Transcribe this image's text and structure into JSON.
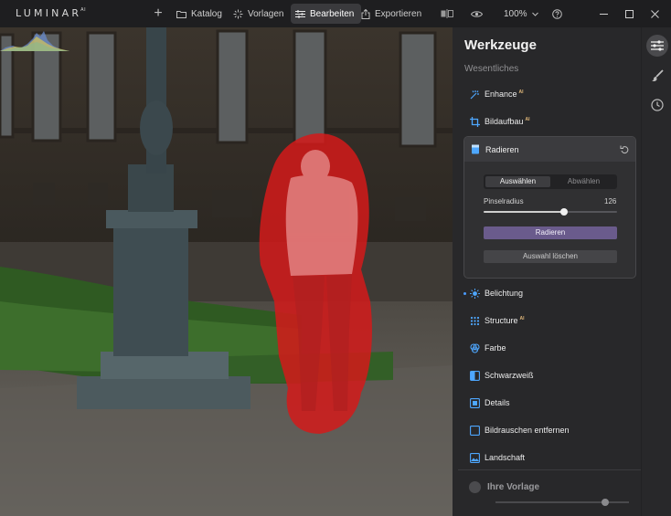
{
  "app": {
    "logo_text": "LUMINAR",
    "logo_suffix": "AI"
  },
  "toolbar": {
    "add_label": "+",
    "katalog_label": "Katalog",
    "vorlagen_label": "Vorlagen",
    "bearbeiten_label": "Bearbeiten",
    "exportieren_label": "Exportieren",
    "zoom_label": "100%"
  },
  "panel": {
    "title": "Werkzeuge",
    "section_label": "Wesentliches",
    "tools": [
      {
        "label": "Enhance",
        "ai": "AI",
        "icon": "enhance-icon",
        "color": "#4ea7ff"
      },
      {
        "label": "Bildaufbau",
        "ai": "AI",
        "icon": "crop-icon",
        "color": "#4ea7ff"
      },
      {
        "label": "Belichtung",
        "ai": "",
        "icon": "sun-icon",
        "color": "#4ea7ff"
      },
      {
        "label": "Structure",
        "ai": "AI",
        "icon": "structure-icon",
        "color": "#4ea7ff"
      },
      {
        "label": "Farbe",
        "ai": "",
        "icon": "color-icon",
        "color": "#4ea7ff"
      },
      {
        "label": "Schwarzweiß",
        "ai": "",
        "icon": "bw-icon",
        "color": "#4ea7ff"
      },
      {
        "label": "Details",
        "ai": "",
        "icon": "details-icon",
        "color": "#4ea7ff"
      },
      {
        "label": "Bildrauschen entfernen",
        "ai": "",
        "icon": "denoise-icon",
        "color": "#4ea7ff"
      },
      {
        "label": "Landschaft",
        "ai": "",
        "icon": "landscape-icon",
        "color": "#4ea7ff"
      }
    ],
    "erase": {
      "title": "Radieren",
      "segment_select": "Auswählen",
      "segment_deselect": "Abwählen",
      "brush_label": "Pinselradius",
      "brush_value": "126",
      "brush_fraction": 0.6,
      "erase_button": "Radieren",
      "clear_button": "Auswahl löschen"
    },
    "preset": {
      "label": "Ihre Vorlage",
      "amount_fraction": 0.82
    }
  },
  "colors": {
    "accent": "#4ea7ff",
    "ai_badge": "#e1b77a",
    "erase_button": "#6a5b8c",
    "mask": "#d41a1a"
  }
}
